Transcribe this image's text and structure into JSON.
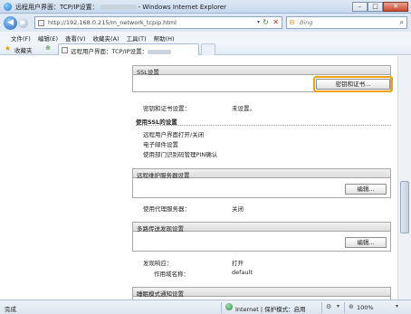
{
  "window": {
    "title": "远程用户界面：TCP/IP设置：",
    "title_suffix": "- Windows Internet Explorer",
    "buttons": {
      "minimize": "–",
      "maximize": "□",
      "close": "✕"
    }
  },
  "address_bar": {
    "url": "http://192.168.0.215/m_network_tcpip.html",
    "search_placeholder": "Bing"
  },
  "menu": [
    "文件(F)",
    "编辑(E)",
    "查看(V)",
    "收藏夹(A)",
    "工具(T)",
    "帮助(H)"
  ],
  "favorites": {
    "label": "收藏夹"
  },
  "tab": {
    "label": "远程用户界面：TCP/IP设置："
  },
  "ssl": {
    "header": "SSL设置",
    "button": "密钥和证书...",
    "key_label": "密钥和证书设置：",
    "key_value": "未设置。",
    "use_ssl_heading": "使用SSL的设置",
    "uses": [
      "远程用户界面打开/关闭",
      "电子邮件设置",
      "使用部门识别码管理PIN确认"
    ]
  },
  "remote": {
    "header": "远程维护服务器设置",
    "edit_button": "编辑...",
    "proxy_label": "使用代理服务器：",
    "proxy_value": "关闭"
  },
  "multicast": {
    "header": "多路传送发现设置",
    "edit_button": "编辑...",
    "response_label": "发现响应：",
    "response_value": "打开",
    "scope_label": "作用域名称：",
    "scope_value": "default"
  },
  "sleep": {
    "header": "睡眠模式通知设置"
  },
  "status": {
    "text": "完成",
    "zone": "Internet | 保护模式：启用",
    "zoom": "100%"
  }
}
